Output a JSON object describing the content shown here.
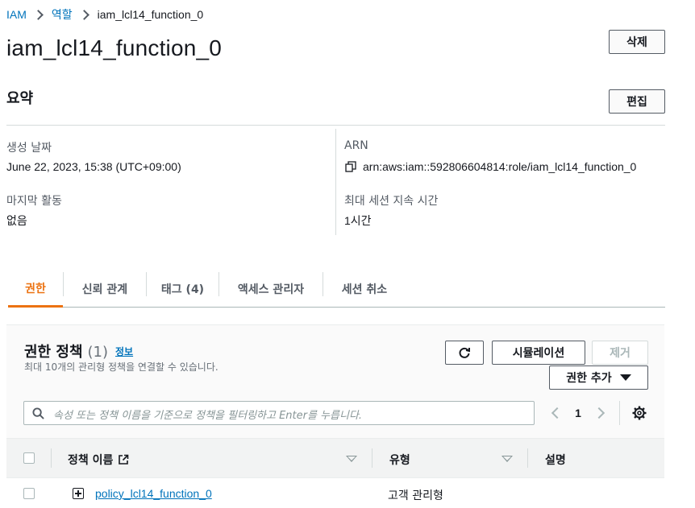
{
  "breadcrumb": {
    "items": [
      "IAM",
      "역할"
    ],
    "current": "iam_lcl14_function_0"
  },
  "page": {
    "title": "iam_lcl14_function_0",
    "delete_label": "삭제"
  },
  "summary": {
    "title": "요약",
    "edit_label": "편집",
    "created_label": "생성 날짜",
    "created_value": "June 22, 2023, 15:38 (UTC+09:00)",
    "last_activity_label": "마지막 활동",
    "last_activity_value": "없음",
    "arn_label": "ARN",
    "arn_value": "arn:aws:iam::592806604814:role/iam_lcl14_function_0",
    "max_session_label": "최대 세션 지속 시간",
    "max_session_value": "1시간"
  },
  "tabs": [
    {
      "label": "권한",
      "active": true
    },
    {
      "label": "신뢰 관계",
      "active": false
    },
    {
      "label": "태그 (4)",
      "active": false
    },
    {
      "label": "액세스 관리자",
      "active": false
    },
    {
      "label": "세션 취소",
      "active": false
    }
  ],
  "policies": {
    "title": "권한 정책",
    "count": "(1)",
    "info_label": "정보",
    "description": "최대 10개의 관리형 정책을 연결할 수 있습니다.",
    "simulate_label": "시뮬레이션",
    "remove_label": "제거",
    "add_permission_label": "권한 추가",
    "search_placeholder": "속성 또는 정책 이름을 기준으로 정책을 필터링하고 Enter를 누릅니다.",
    "page_number": "1",
    "columns": [
      "정책 이름",
      "유형",
      "설명"
    ],
    "rows": [
      {
        "name": "policy_lcl14_function_0",
        "type": "고객 관리형",
        "description": ""
      }
    ]
  },
  "colors": {
    "link": "#0073bb",
    "active_tab": "#ec7211",
    "text": "#16191f",
    "muted": "#545b64"
  }
}
